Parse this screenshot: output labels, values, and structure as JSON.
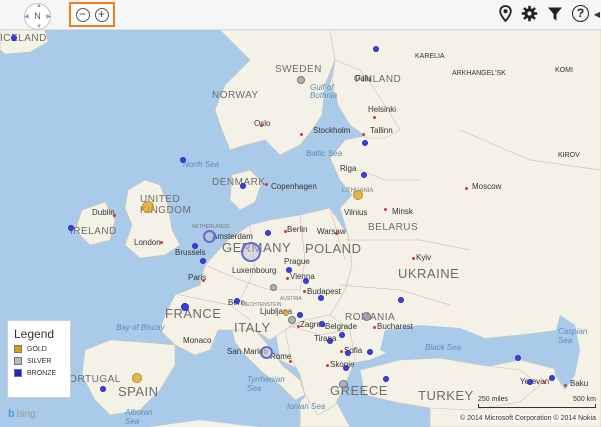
{
  "toolbar": {
    "compass_label": "N",
    "zoom_out_glyph": "−",
    "zoom_in_glyph": "+",
    "icons": [
      "map-pin-icon",
      "gear-icon",
      "filter-icon",
      "help-icon"
    ],
    "help_glyph": "?",
    "collapse_glyph": "◀"
  },
  "labels": {
    "iceland": "ICELAND",
    "sweden": "SWEDEN",
    "finland": "FINLAND",
    "norway": "NORWAY",
    "karelia": "KARELIA",
    "arkhangelsk": "ARKHANGEL'SK",
    "komi": "KOMI",
    "gulf_bothnia": "Gulf of Bothnia",
    "oulu": "Oulu",
    "helsinki": "Helsinki",
    "stockholm": "Stockholm",
    "tallinn": "Tallinn",
    "oslo": "Oslo",
    "baltic_sea": "Baltic Sea",
    "north_sea": "North Sea",
    "riga": "Riga",
    "moscow": "Moscow",
    "kirov": "KIROV",
    "denmark": "DENMARK",
    "copenhagen": "Copenhagen",
    "lithuania": "LITHUANIA",
    "vilnius": "Vilnius",
    "minsk": "Minsk",
    "belarus": "BELARUS",
    "united_kingdom": "UNITED\nKINGDOM",
    "dublin": "Dublin",
    "ireland": "IRELAND",
    "london": "London",
    "netherlands": "NETHERLANDS",
    "amsterdam": "Amsterdam",
    "berlin": "Berlin",
    "warsaw": "Warsaw",
    "poland": "POLAND",
    "brussels": "Brussels",
    "germany": "GERMANY",
    "prague": "Prague",
    "kyiv": "Kyiv",
    "ukraine": "UKRAINE",
    "luxembourg": "Luxembourg",
    "paris": "Paris",
    "vienna": "Vienna",
    "austria": "AUSTRIA",
    "budapest": "Budapest",
    "bern": "Bern",
    "france": "FRANCE",
    "liechtenstein": "LIECHTENSTEIN",
    "romania": "ROMANIA",
    "bay_of_biscay": "Bay of Biscay",
    "ljubljana": "Ljubljana",
    "zagreb": "Zagreb",
    "belgrade": "Belgrade",
    "italy": "ITALY",
    "bucharest": "Bucharest",
    "monaco": "Monaco",
    "san_marino": "San Marino",
    "caspian_sea": "Caspian\nSea",
    "black_sea": "Black Sea",
    "tirana": "Tirana",
    "sofia": "Sofia",
    "rome": "Rome",
    "portugal": "PORTUGAL",
    "spain": "SPAIN",
    "tyrrhenian_sea": "Tyrrhenian\nSea",
    "skopje": "Skopje",
    "greece": "GREECE",
    "turkey": "TURKEY",
    "yerevan": "Yerevan",
    "baku": "Baku",
    "alboran_sea": "Alboran\nSea",
    "ionian_sea": "Ionian Sea"
  },
  "legend": {
    "title": "Legend",
    "items": [
      {
        "label": "GOLD",
        "color": "#d4a017"
      },
      {
        "label": "SILVER",
        "color": "#b8b8c0"
      },
      {
        "label": "BRONZE",
        "color": "#2020e0"
      }
    ]
  },
  "footer": {
    "brand": "bing",
    "copyright": "© 2014 Microsoft Corporation   © 2014 Nokia",
    "scale_miles": "250 miles",
    "scale_km": "500 km"
  },
  "colors": {
    "water": "#a9cbe9",
    "land": "#f4f1e6",
    "zoom_highlight": "#ee7a23"
  }
}
